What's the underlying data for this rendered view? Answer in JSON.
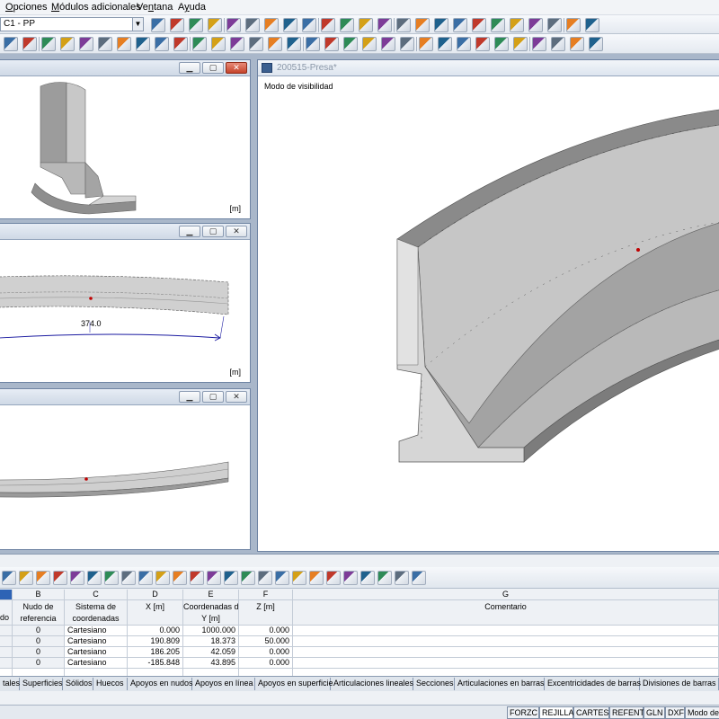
{
  "menu": {
    "items": [
      {
        "label": "Opciones",
        "underline": "O"
      },
      {
        "label": "Módulos adicionales",
        "underline": "M"
      },
      {
        "label": "Ventana",
        "underline": "n"
      },
      {
        "label": "Ayuda",
        "underline": "y"
      }
    ]
  },
  "toolbar": {
    "load_case_combo": "C1 - PP"
  },
  "windows": {
    "main_title": "200515-Presa*",
    "main_caption": "Modo de visibilidad",
    "unit_label": "[m]",
    "dimension_label": "374.0"
  },
  "table": {
    "columns": [
      {
        "letter": "B",
        "line1": "Nudo de",
        "line2": "referencia"
      },
      {
        "letter": "C",
        "line1": "Sistema de",
        "line2": "coordenadas"
      },
      {
        "letter": "D",
        "line1": "",
        "line2": "X [m]"
      },
      {
        "letter": "E",
        "line1": "Coordenadas del nudo",
        "line2": "Y [m]"
      },
      {
        "letter": "F",
        "line1": "",
        "line2": "Z [m]"
      },
      {
        "letter": "G",
        "line1": "",
        "line2": "Comentario"
      }
    ],
    "first_col_fragment": "do",
    "rows": [
      {
        "ref": "0",
        "system": "Cartesiano",
        "x": "0.000",
        "y": "1000.000",
        "z": "0.000"
      },
      {
        "ref": "0",
        "system": "Cartesiano",
        "x": "190.809",
        "y": "18.373",
        "z": "50.000"
      },
      {
        "ref": "0",
        "system": "Cartesiano",
        "x": "186.205",
        "y": "42.059",
        "z": "0.000"
      },
      {
        "ref": "0",
        "system": "Cartesiano",
        "x": "-185.848",
        "y": "43.895",
        "z": "0.000"
      }
    ],
    "tabs": [
      "tales",
      "Superficies",
      "Sólidos",
      "Huecos",
      "Apoyos en nudos",
      "Apoyos en línea",
      "Apoyos en superficie",
      "Articulaciones lineales",
      "Secciones",
      "Articulaciones en barras",
      "Excentricidades de barras",
      "Divisiones de barras",
      "Ba"
    ]
  },
  "status": {
    "buttons": [
      "FORZC",
      "REJILLA",
      "CARTES",
      "REFENT",
      "GLN",
      "DXF",
      "Modo de"
    ]
  },
  "colors": {
    "workspace": "#a9b7ca",
    "surface_light": "#d4d4d4",
    "surface_mid": "#b4b4b4",
    "surface_dark": "#7c7c7c",
    "node": "#c00000",
    "dimension_line": "#1a1aa0"
  }
}
